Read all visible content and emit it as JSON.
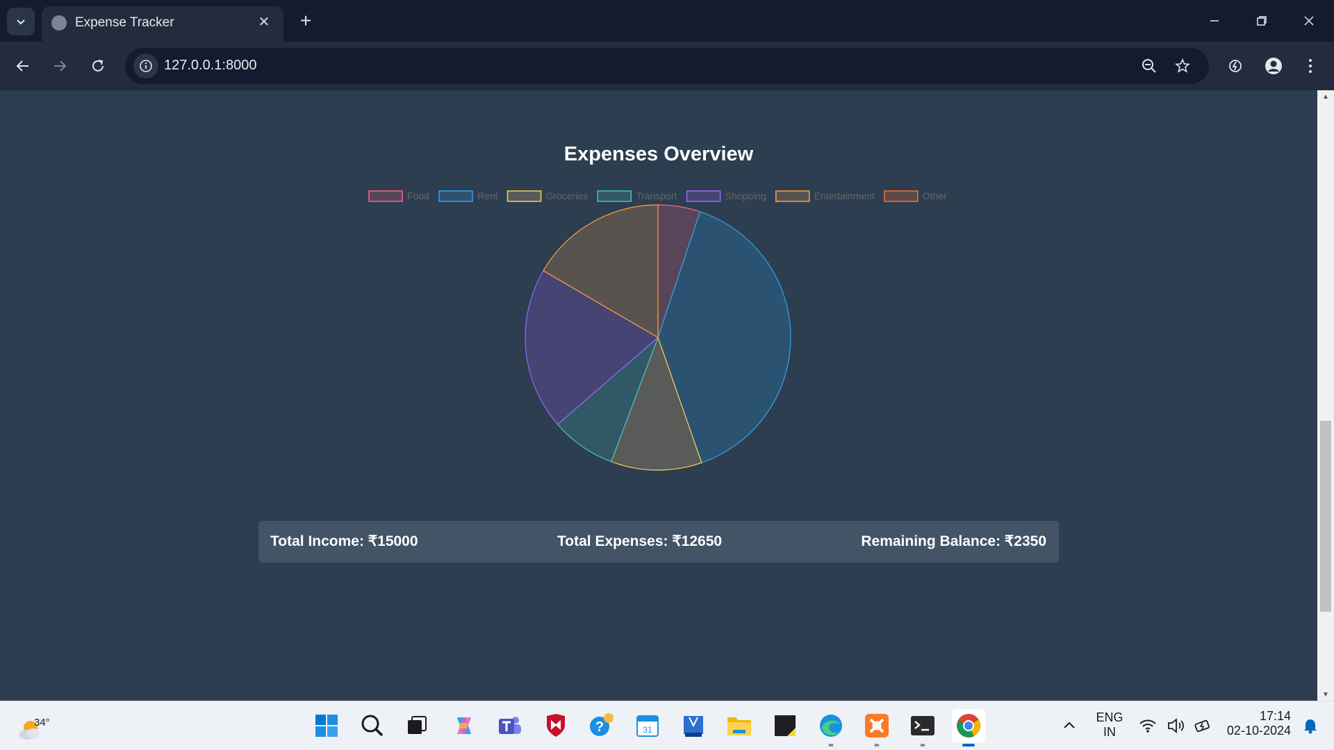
{
  "browser": {
    "tab_title": "Expense Tracker",
    "url": "127.0.0.1:8000"
  },
  "page": {
    "chart_title": "Expenses Overview",
    "summary": {
      "income": "Total Income: ₹15000",
      "expenses": "Total Expenses: ₹12650",
      "balance": "Remaining Balance: ₹2350"
    }
  },
  "chart_data": {
    "type": "pie",
    "title": "Expenses Overview",
    "legend_position": "top",
    "categories": [
      "Food",
      "Rent",
      "Groceries",
      "Transport",
      "Shopping",
      "Entertainment",
      "Other"
    ],
    "values": [
      650,
      5000,
      1400,
      1000,
      2500,
      2100,
      0
    ],
    "colors": {
      "borders": [
        "#ff6384",
        "#36a2eb",
        "#ffce56",
        "#4bc0c0",
        "#9966ff",
        "#ff9f40",
        "#ff6b35"
      ],
      "fills": [
        "#584559",
        "#2c5271",
        "#585b57",
        "#315866",
        "#454473",
        "#59534f",
        "#5c4a45"
      ]
    }
  },
  "taskbar": {
    "weather_temp": "34°",
    "lang_line1": "ENG",
    "lang_line2": "IN",
    "time": "17:14",
    "date": "02-10-2024"
  }
}
